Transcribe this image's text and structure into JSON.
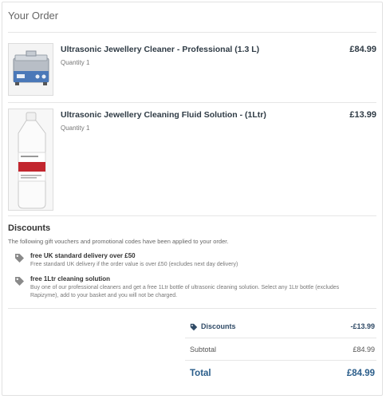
{
  "header": {
    "title": "Your Order"
  },
  "items": [
    {
      "name": "Ultrasonic Jewellery Cleaner - Professional (1.3 L)",
      "quantity": "Quantity 1",
      "price": "£84.99",
      "image": "ultrasonic-cleaner-image"
    },
    {
      "name": "Ultrasonic Jewellery Cleaning Fluid Solution - (1Ltr)",
      "quantity": "Quantity 1",
      "price": "£13.99",
      "image": "cleaning-fluid-bottle-image"
    }
  ],
  "discounts": {
    "title": "Discounts",
    "intro": "The following gift vouchers and promotional codes have been applied to your order.",
    "list": [
      {
        "name": "free UK standard delivery over £50",
        "description": "Free standard UK delivery if the order value is over £50 (excludes next day delivery)",
        "icon": "tag-icon"
      },
      {
        "name": "free 1Ltr cleaning solution",
        "description": "Buy one of our professional cleaners and get a free 1Ltr bottle of ultrasonic cleaning solution. Select any 1Ltr bottle (excludes Rapizyme), add to your basket and you will not be charged.",
        "icon": "tag-icon"
      }
    ]
  },
  "summary": {
    "discounts_label": "Discounts",
    "discounts_value": "-£13.99",
    "subtotal_label": "Subtotal",
    "subtotal_value": "£84.99",
    "total_label": "Total",
    "total_value": "£84.99"
  },
  "colors": {
    "accent": "#2a5d8a",
    "text_dark": "#2f3b45",
    "divider": "#e6e6e6"
  }
}
